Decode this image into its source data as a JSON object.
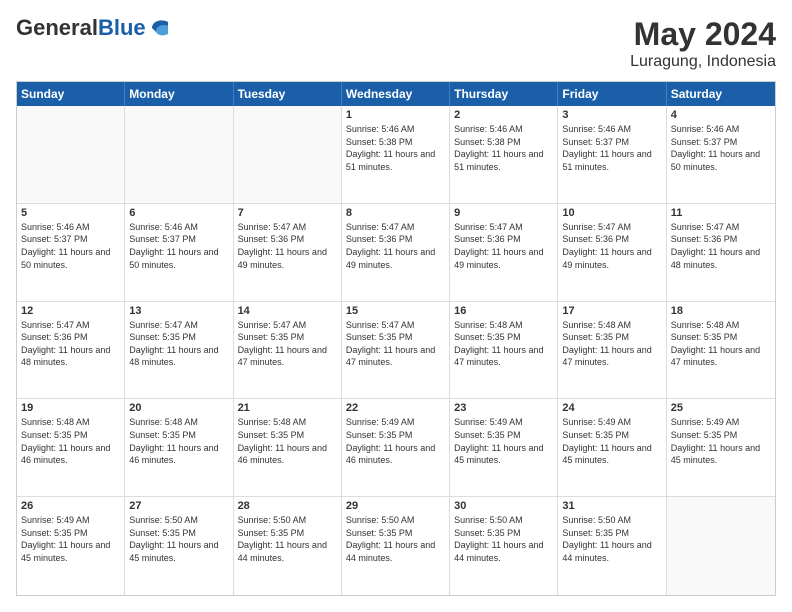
{
  "header": {
    "logo": {
      "general": "General",
      "blue": "Blue"
    },
    "title": "May 2024",
    "location": "Luragung, Indonesia"
  },
  "calendar": {
    "days_of_week": [
      "Sunday",
      "Monday",
      "Tuesday",
      "Wednesday",
      "Thursday",
      "Friday",
      "Saturday"
    ],
    "rows": [
      [
        {
          "date": "",
          "info": "",
          "empty": true
        },
        {
          "date": "",
          "info": "",
          "empty": true
        },
        {
          "date": "",
          "info": "",
          "empty": true
        },
        {
          "date": "1",
          "info": "Sunrise: 5:46 AM\nSunset: 5:38 PM\nDaylight: 11 hours and 51 minutes."
        },
        {
          "date": "2",
          "info": "Sunrise: 5:46 AM\nSunset: 5:38 PM\nDaylight: 11 hours and 51 minutes."
        },
        {
          "date": "3",
          "info": "Sunrise: 5:46 AM\nSunset: 5:37 PM\nDaylight: 11 hours and 51 minutes."
        },
        {
          "date": "4",
          "info": "Sunrise: 5:46 AM\nSunset: 5:37 PM\nDaylight: 11 hours and 50 minutes."
        }
      ],
      [
        {
          "date": "5",
          "info": "Sunrise: 5:46 AM\nSunset: 5:37 PM\nDaylight: 11 hours and 50 minutes."
        },
        {
          "date": "6",
          "info": "Sunrise: 5:46 AM\nSunset: 5:37 PM\nDaylight: 11 hours and 50 minutes."
        },
        {
          "date": "7",
          "info": "Sunrise: 5:47 AM\nSunset: 5:36 PM\nDaylight: 11 hours and 49 minutes."
        },
        {
          "date": "8",
          "info": "Sunrise: 5:47 AM\nSunset: 5:36 PM\nDaylight: 11 hours and 49 minutes."
        },
        {
          "date": "9",
          "info": "Sunrise: 5:47 AM\nSunset: 5:36 PM\nDaylight: 11 hours and 49 minutes."
        },
        {
          "date": "10",
          "info": "Sunrise: 5:47 AM\nSunset: 5:36 PM\nDaylight: 11 hours and 49 minutes."
        },
        {
          "date": "11",
          "info": "Sunrise: 5:47 AM\nSunset: 5:36 PM\nDaylight: 11 hours and 48 minutes."
        }
      ],
      [
        {
          "date": "12",
          "info": "Sunrise: 5:47 AM\nSunset: 5:36 PM\nDaylight: 11 hours and 48 minutes."
        },
        {
          "date": "13",
          "info": "Sunrise: 5:47 AM\nSunset: 5:35 PM\nDaylight: 11 hours and 48 minutes."
        },
        {
          "date": "14",
          "info": "Sunrise: 5:47 AM\nSunset: 5:35 PM\nDaylight: 11 hours and 47 minutes."
        },
        {
          "date": "15",
          "info": "Sunrise: 5:47 AM\nSunset: 5:35 PM\nDaylight: 11 hours and 47 minutes."
        },
        {
          "date": "16",
          "info": "Sunrise: 5:48 AM\nSunset: 5:35 PM\nDaylight: 11 hours and 47 minutes."
        },
        {
          "date": "17",
          "info": "Sunrise: 5:48 AM\nSunset: 5:35 PM\nDaylight: 11 hours and 47 minutes."
        },
        {
          "date": "18",
          "info": "Sunrise: 5:48 AM\nSunset: 5:35 PM\nDaylight: 11 hours and 47 minutes."
        }
      ],
      [
        {
          "date": "19",
          "info": "Sunrise: 5:48 AM\nSunset: 5:35 PM\nDaylight: 11 hours and 46 minutes."
        },
        {
          "date": "20",
          "info": "Sunrise: 5:48 AM\nSunset: 5:35 PM\nDaylight: 11 hours and 46 minutes."
        },
        {
          "date": "21",
          "info": "Sunrise: 5:48 AM\nSunset: 5:35 PM\nDaylight: 11 hours and 46 minutes."
        },
        {
          "date": "22",
          "info": "Sunrise: 5:49 AM\nSunset: 5:35 PM\nDaylight: 11 hours and 46 minutes."
        },
        {
          "date": "23",
          "info": "Sunrise: 5:49 AM\nSunset: 5:35 PM\nDaylight: 11 hours and 45 minutes."
        },
        {
          "date": "24",
          "info": "Sunrise: 5:49 AM\nSunset: 5:35 PM\nDaylight: 11 hours and 45 minutes."
        },
        {
          "date": "25",
          "info": "Sunrise: 5:49 AM\nSunset: 5:35 PM\nDaylight: 11 hours and 45 minutes."
        }
      ],
      [
        {
          "date": "26",
          "info": "Sunrise: 5:49 AM\nSunset: 5:35 PM\nDaylight: 11 hours and 45 minutes."
        },
        {
          "date": "27",
          "info": "Sunrise: 5:50 AM\nSunset: 5:35 PM\nDaylight: 11 hours and 45 minutes."
        },
        {
          "date": "28",
          "info": "Sunrise: 5:50 AM\nSunset: 5:35 PM\nDaylight: 11 hours and 44 minutes."
        },
        {
          "date": "29",
          "info": "Sunrise: 5:50 AM\nSunset: 5:35 PM\nDaylight: 11 hours and 44 minutes."
        },
        {
          "date": "30",
          "info": "Sunrise: 5:50 AM\nSunset: 5:35 PM\nDaylight: 11 hours and 44 minutes."
        },
        {
          "date": "31",
          "info": "Sunrise: 5:50 AM\nSunset: 5:35 PM\nDaylight: 11 hours and 44 minutes."
        },
        {
          "date": "",
          "info": "",
          "empty": true
        }
      ]
    ]
  }
}
